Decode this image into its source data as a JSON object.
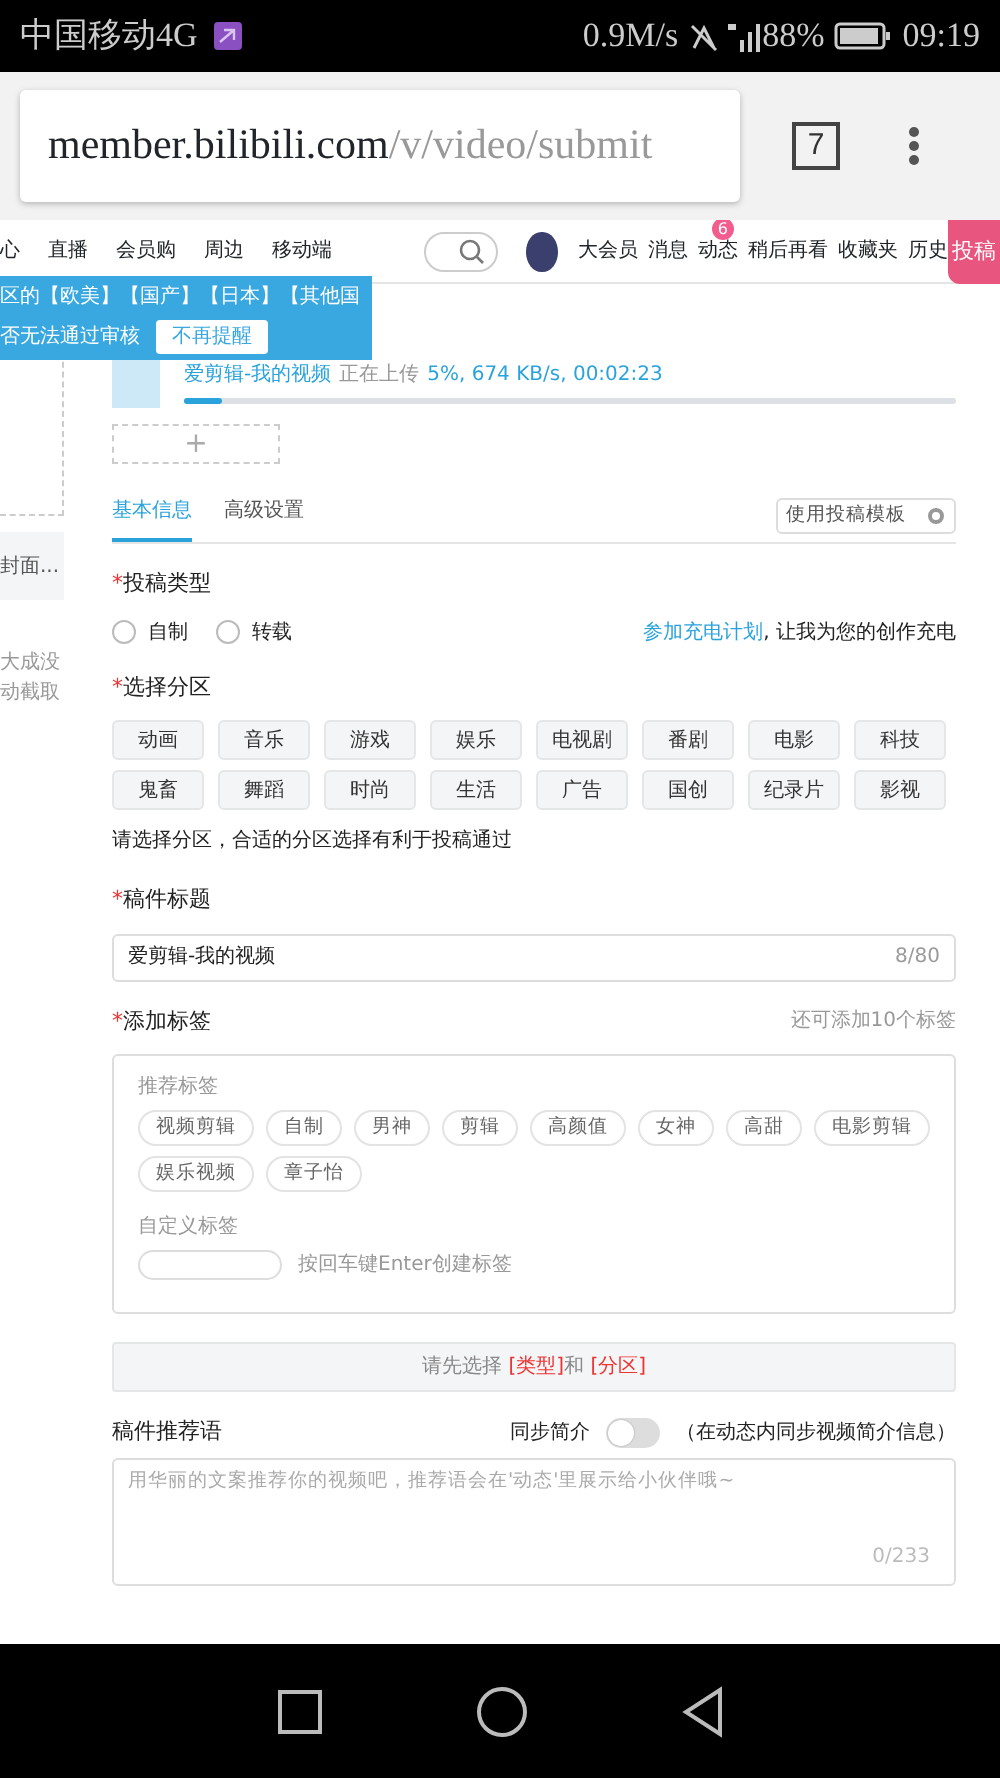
{
  "status_bar": {
    "carrier": "中国移动4G",
    "speed": "0.9M/s",
    "battery": "88%",
    "time": "09:19"
  },
  "browser": {
    "url_host": "member.bilibili.com",
    "url_path": "/v/video/submit",
    "tab_count": "7"
  },
  "nav": {
    "left_items": [
      "心",
      "直播",
      "会员购",
      "周边",
      "移动端"
    ],
    "right_items": [
      {
        "label": "大会员"
      },
      {
        "label": "消息"
      },
      {
        "label": "动态",
        "badge": "6"
      },
      {
        "label": "稍后再看"
      },
      {
        "label": "收藏夹"
      },
      {
        "label": "历史"
      }
    ],
    "submit_button": "投稿"
  },
  "sidebar_fragments": [
    "封面...",
    "大成没",
    "动截取"
  ],
  "notice_popup": {
    "line_1": "区的【欧美】【国产】【日本】【其他国",
    "line_2": "否无法通过审核",
    "button": "不再提醒"
  },
  "upload": {
    "filename": "爱剪辑-我的视频",
    "status": "正在上传",
    "progress_text": "5%, 674 KB/s, 00:02:23",
    "level": 0.05,
    "add_button": "+"
  },
  "tabs": [
    {
      "label": "基本信息",
      "selected": true
    },
    {
      "label": "高级设置",
      "selected": false
    }
  ],
  "template_button": "使用投稿模板",
  "type_section": {
    "mark": "*",
    "label": "投稿类型",
    "options": [
      {
        "label": "自制",
        "selected": false
      },
      {
        "label": "转载",
        "selected": false
      }
    ],
    "charge_link": "参加充电计划",
    "charge_text": ", 让我为您的创作充电"
  },
  "category_section": {
    "mark": "*",
    "label": "选择分区",
    "hint": "请选择分区，合适的分区选择有利于投稿通过",
    "items": [
      {
        "label": "动画",
        "selected": false
      },
      {
        "label": "音乐",
        "selected": false
      },
      {
        "label": "游戏",
        "selected": false
      },
      {
        "label": "娱乐",
        "selected": false
      },
      {
        "label": "电视剧",
        "selected": false
      },
      {
        "label": "番剧",
        "selected": false
      },
      {
        "label": "电影",
        "selected": false
      },
      {
        "label": "科技",
        "selected": false
      },
      {
        "label": "鬼畜",
        "selected": false
      },
      {
        "label": "舞蹈",
        "selected": false
      },
      {
        "label": "时尚",
        "selected": false
      },
      {
        "label": "生活",
        "selected": false
      },
      {
        "label": "广告",
        "selected": false
      },
      {
        "label": "国创",
        "selected": false
      },
      {
        "label": "纪录片",
        "selected": false
      },
      {
        "label": "影视",
        "selected": false
      }
    ]
  },
  "title_section": {
    "mark": "*",
    "label": "稿件标题",
    "value": "爱剪辑-我的视频",
    "counter": "8/80"
  },
  "tag_section": {
    "mark": "*",
    "label": "添加标签",
    "remaining": "还可添加10个标签",
    "recommended_label": "推荐标签",
    "recommended": [
      "视频剪辑",
      "自制",
      "男神",
      "剪辑",
      "高颜值",
      "女神",
      "高甜",
      "电影剪辑",
      "娱乐视频",
      "章子怡"
    ],
    "custom_label": "自定义标签",
    "custom_hint": "按回车键Enter创建标签"
  },
  "notice_bar": {
    "prefix": "请先选择 ",
    "highlight_1": "[类型]",
    "middle": "和 ",
    "highlight_2": "[分区]"
  },
  "recommend_section": {
    "label": "稿件推荐语",
    "sync_label": "同步简介",
    "sync_on": false,
    "sync_note": "（在动态内同步视频简介信息）",
    "placeholder": "用华丽的文案推荐你的视频吧，推荐语会在'动态'里展示给小伙伴哦~",
    "counter": "0/233"
  }
}
